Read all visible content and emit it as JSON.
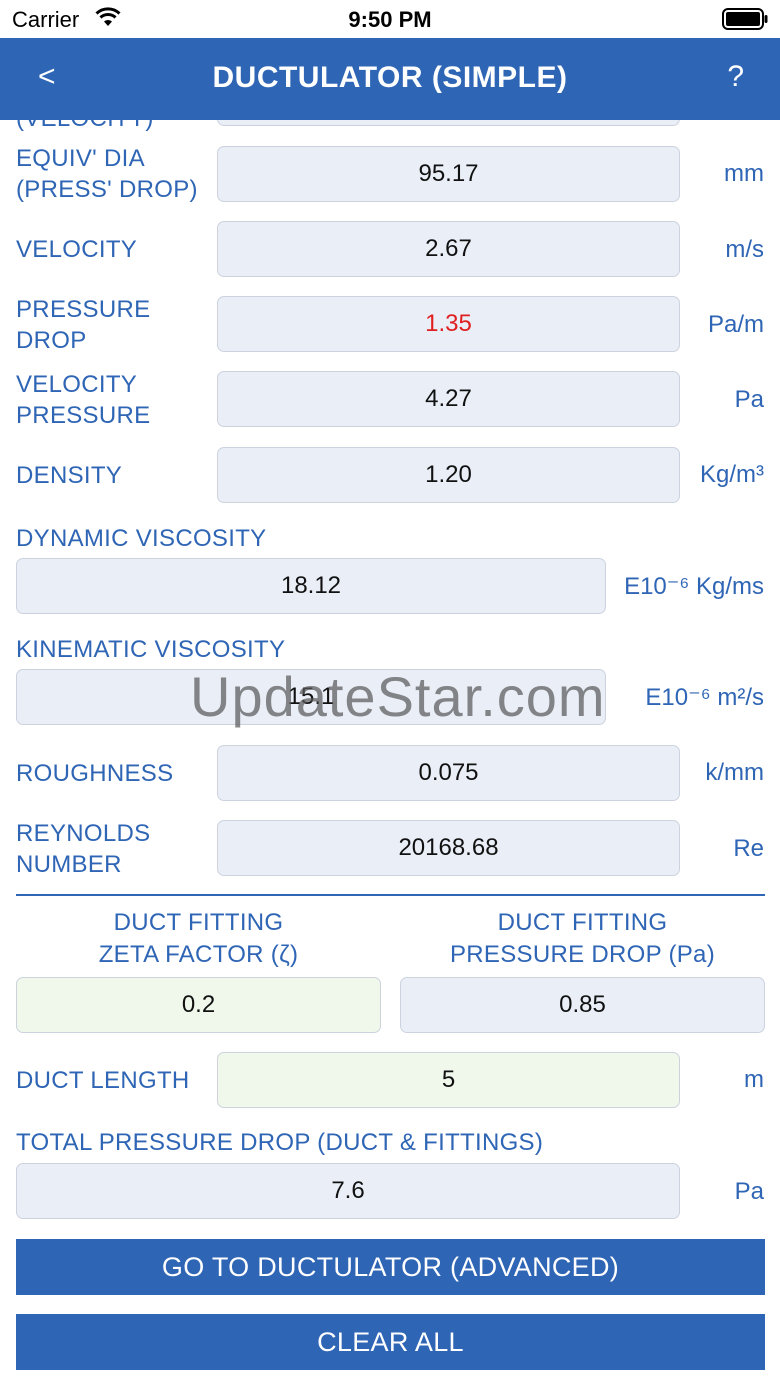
{
  "status": {
    "carrier": "Carrier",
    "time": "9:50 PM"
  },
  "nav": {
    "back": "<",
    "title": "DUCTULATOR (SIMPLE)",
    "help": "?"
  },
  "rows": {
    "velocity_cut": {
      "label": "(VELOCITY)"
    },
    "equiv_dia": {
      "label_l1": "EQUIV' DIA",
      "label_l2": "(PRESS' DROP)",
      "value": "95.17",
      "unit": "mm"
    },
    "velocity": {
      "label": "VELOCITY",
      "value": "2.67",
      "unit": "m/s"
    },
    "pressure_drop": {
      "label_l1": "PRESSURE",
      "label_l2": "DROP",
      "value": "1.35",
      "unit": "Pa/m"
    },
    "velocity_pressure": {
      "label_l1": "VELOCITY",
      "label_l2": "PRESSURE",
      "value": "4.27",
      "unit": "Pa"
    },
    "density": {
      "label": "DENSITY",
      "value": "1.20",
      "unit": "Kg/m³"
    },
    "dynamic_viscosity": {
      "label": "DYNAMIC VISCOSITY",
      "value": "18.12",
      "unit": "E10⁻⁶ Kg/ms"
    },
    "kinematic_viscosity": {
      "label": "KINEMATIC VISCOSITY",
      "value": "15.1",
      "unit": "E10⁻⁶ m²/s"
    },
    "roughness": {
      "label": "ROUGHNESS",
      "value": "0.075",
      "unit": "k/mm"
    },
    "reynolds": {
      "label_l1": "REYNOLDS",
      "label_l2": "NUMBER",
      "value": "20168.68",
      "unit": "Re"
    }
  },
  "fittings": {
    "zeta_l1": "DUCT FITTING",
    "zeta_l2": "ZETA FACTOR (ζ)",
    "zeta_value": "0.2",
    "pd_l1": "DUCT FITTING",
    "pd_l2": "PRESSURE DROP (Pa)",
    "pd_value": "0.85"
  },
  "duct_length": {
    "label": "DUCT LENGTH",
    "value": "5",
    "unit": "m"
  },
  "total": {
    "label": "TOTAL PRESSURE DROP (DUCT & FITTINGS)",
    "value": "7.6",
    "unit": "Pa"
  },
  "buttons": {
    "advanced": "GO TO DUCTULATOR (ADVANCED)",
    "clear": "CLEAR ALL"
  },
  "watermark": "UpdateStar.com",
  "colors": {
    "accent": "#2f65b5",
    "field_bg": "#e9eef7",
    "field_green": "#eff8ea",
    "warning": "#e02020"
  }
}
